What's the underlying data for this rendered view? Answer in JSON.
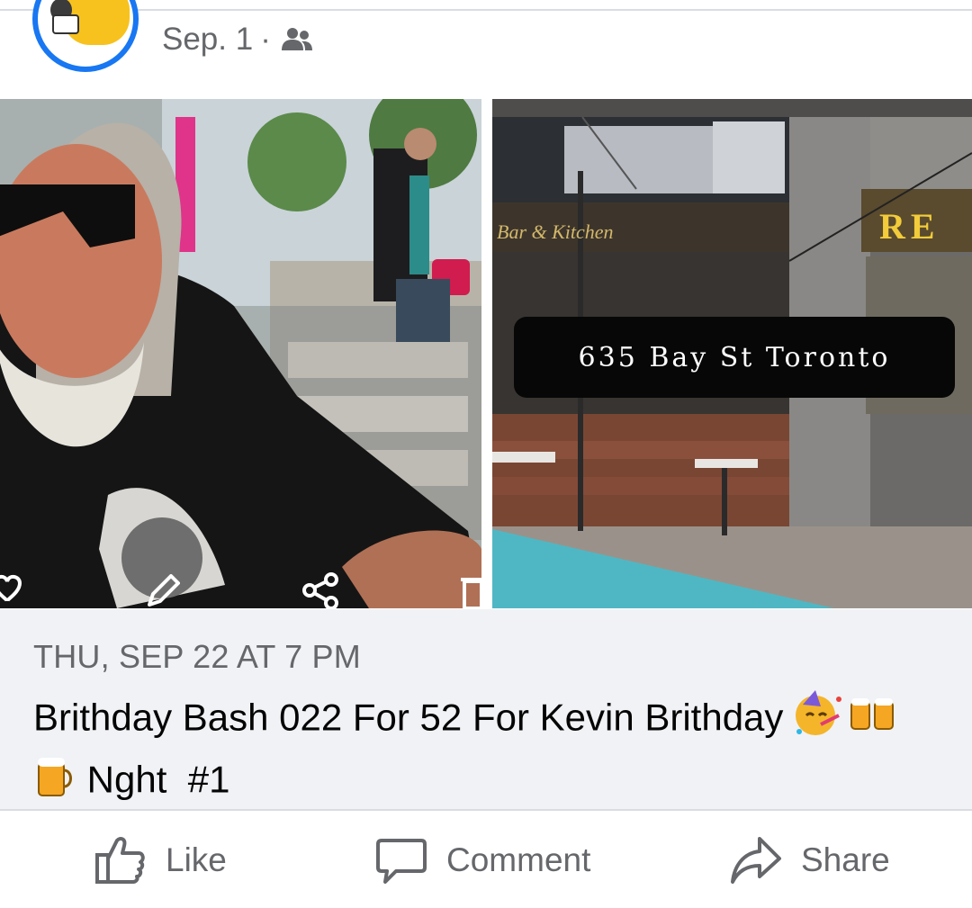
{
  "post": {
    "date": "Sep. 1",
    "separator": "·",
    "audience_icon": "friends-icon"
  },
  "photos": {
    "left_alt": "man with sunglasses and beard",
    "right_alt": "bar storefront",
    "right_sign_text": "Bar & Kitchen",
    "right_sign2_text": "RE",
    "caption": "635 Bay St Toronto"
  },
  "event": {
    "datetime": "THU, SEP 22 AT 7 PM",
    "title_line1": "Brithday Bash 022 For 52 For Kevin Brithday",
    "title_line2": "Nght  #1"
  },
  "actions": {
    "like_label": "Like",
    "comment_label": "Comment",
    "share_label": "Share"
  },
  "colors": {
    "accent": "#1877f2",
    "muted_text": "#65676b",
    "event_bg": "#f0f2f5"
  }
}
